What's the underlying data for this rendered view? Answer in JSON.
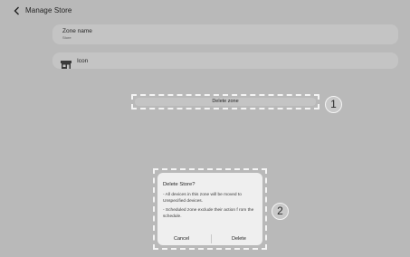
{
  "header": {
    "title": "Manage Store"
  },
  "zone_name": {
    "label": "Zone name",
    "value": "Store"
  },
  "icon_row": {
    "label": "Icon",
    "icon": "store-icon"
  },
  "delete_zone": {
    "label": "Delete zone"
  },
  "badges": [
    "1",
    "2"
  ],
  "dialog": {
    "title": "Delete Store?",
    "text1": "- All devices in this zone will be moved to Unspecified devices.",
    "text2": "- Scheduled zone exclude their action f rom the schedule.",
    "cancel": "Cancel",
    "delete": "Delete"
  }
}
